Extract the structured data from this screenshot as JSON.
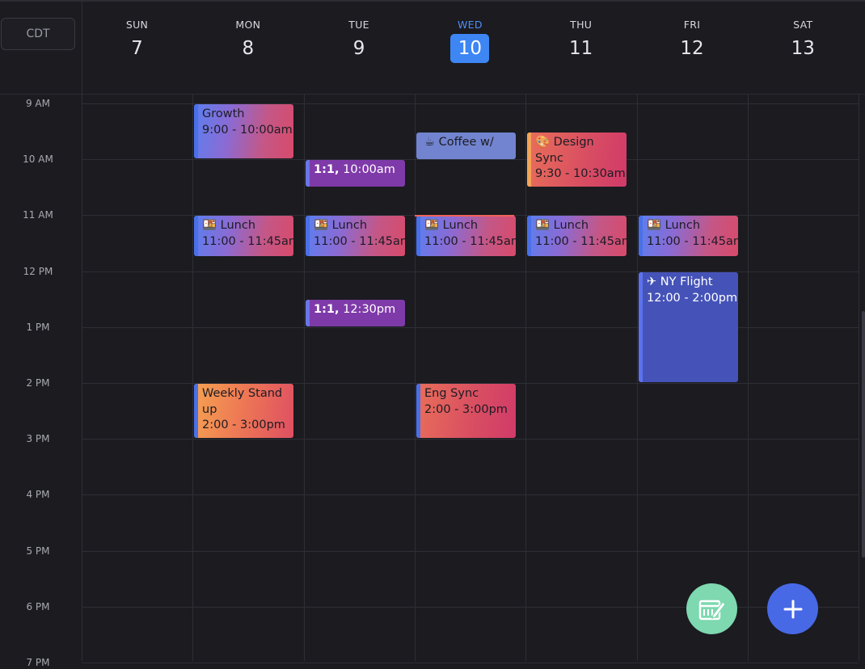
{
  "timezone": "CDT",
  "today_index": 3,
  "days": [
    {
      "name": "SUN",
      "num": "7"
    },
    {
      "name": "MON",
      "num": "8"
    },
    {
      "name": "TUE",
      "num": "9"
    },
    {
      "name": "WED",
      "num": "10"
    },
    {
      "name": "THU",
      "num": "11"
    },
    {
      "name": "FRI",
      "num": "12"
    },
    {
      "name": "SAT",
      "num": "13"
    }
  ],
  "hours": [
    "9 AM",
    "10 AM",
    "11 AM",
    "12 PM",
    "1 PM",
    "2 PM",
    "3 PM",
    "4 PM",
    "5 PM",
    "6 PM",
    "7 PM"
  ],
  "events": [
    {
      "day": 1,
      "start": 9.0,
      "end": 10.0,
      "title": "Growth",
      "time": "9:00 - 10:00am",
      "style": "grad-a"
    },
    {
      "day": 1,
      "start": 11.0,
      "end": 11.75,
      "title": "🍱 Lunch",
      "time": "11:00 - 11:45am",
      "style": "grad-a"
    },
    {
      "day": 1,
      "start": 14.0,
      "end": 15.0,
      "title": "Weekly Stand up",
      "time": "2:00 - 3:00pm",
      "style": "grad-b"
    },
    {
      "day": 2,
      "start": 10.0,
      "end": 10.5,
      "title": "1:1,",
      "time": "10:00am",
      "style": "purple",
      "inline": true
    },
    {
      "day": 2,
      "start": 11.0,
      "end": 11.75,
      "title": "🍱 Lunch",
      "time": "11:00 - 11:45am",
      "style": "grad-a"
    },
    {
      "day": 2,
      "start": 12.5,
      "end": 13.0,
      "title": "1:1,",
      "time": "12:30pm",
      "style": "purple",
      "inline": true
    },
    {
      "day": 3,
      "start": 9.5,
      "end": 10.0,
      "title": "☕ Coffee w/",
      "time": "",
      "style": "coffee"
    },
    {
      "day": 3,
      "start": 11.0,
      "end": 11.75,
      "title": "🍱 Lunch",
      "time": "11:00 - 11:45am",
      "style": "grad-a"
    },
    {
      "day": 3,
      "start": 14.0,
      "end": 15.0,
      "title": "Eng Sync",
      "time": "2:00 - 3:00pm",
      "style": "grad-c"
    },
    {
      "day": 4,
      "start": 9.5,
      "end": 10.5,
      "title": "🎨 Design Sync",
      "time": "9:30 - 10:30am",
      "style": "grad-c design"
    },
    {
      "day": 4,
      "start": 11.0,
      "end": 11.75,
      "title": "🍱 Lunch",
      "time": "11:00 - 11:45am",
      "style": "grad-a"
    },
    {
      "day": 5,
      "start": 11.0,
      "end": 11.75,
      "title": "🍱 Lunch",
      "time": "11:00 - 11:45am",
      "style": "grad-a"
    },
    {
      "day": 5,
      "start": 12.0,
      "end": 14.0,
      "title": "✈ NY Flight",
      "time": "12:00 - 2:00pm",
      "style": "flight"
    }
  ],
  "current_time": {
    "day": 3,
    "hour": 11.0
  },
  "colors": {
    "background": "#1b1b20",
    "today_accent": "#3d86f4",
    "now_line": "#f0625a",
    "fab_green": "#7ed8b0",
    "fab_blue": "#4869e6",
    "flight": "#4553b8",
    "one_on_one": "#7f3aa9"
  },
  "icons": {
    "fab_left": "calendar-edit-icon",
    "fab_right": "plus-icon"
  }
}
